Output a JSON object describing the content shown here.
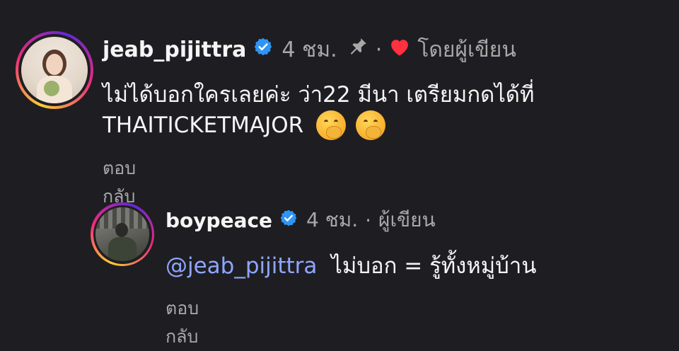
{
  "comment1": {
    "username": "jeab_pijittra",
    "time": "4 ชม.",
    "separator": "·",
    "liked_by_author": "โดยผู้เขียน",
    "text_line1": "ไม่ได้บอกใครเลยค่ะ ว่า22 มีนา เตรียมกดได้ที่",
    "text_line2": "THAITICKETMAJOR",
    "emoji_1": "🤭",
    "emoji_2": "🤭",
    "reply_label": "ตอบกลับ",
    "icons": [
      "verified-badge-icon",
      "pin-icon",
      "heart-icon"
    ]
  },
  "comment2": {
    "username": "boypeace",
    "time": "4 ชม.",
    "separator": "·",
    "author_label": "ผู้เขียน",
    "mention": "@jeab_pijittra",
    "text": "ไม่บอก = รู้ทั้งหมู่บ้าน",
    "reply_label": "ตอบกลับ",
    "icons": [
      "verified-badge-icon"
    ]
  },
  "colors": {
    "background": "#1e1e22",
    "verified": "#2f95f5",
    "heart": "#ff3040",
    "mention": "#8fa6ff",
    "muted": "#a8a8a8"
  }
}
